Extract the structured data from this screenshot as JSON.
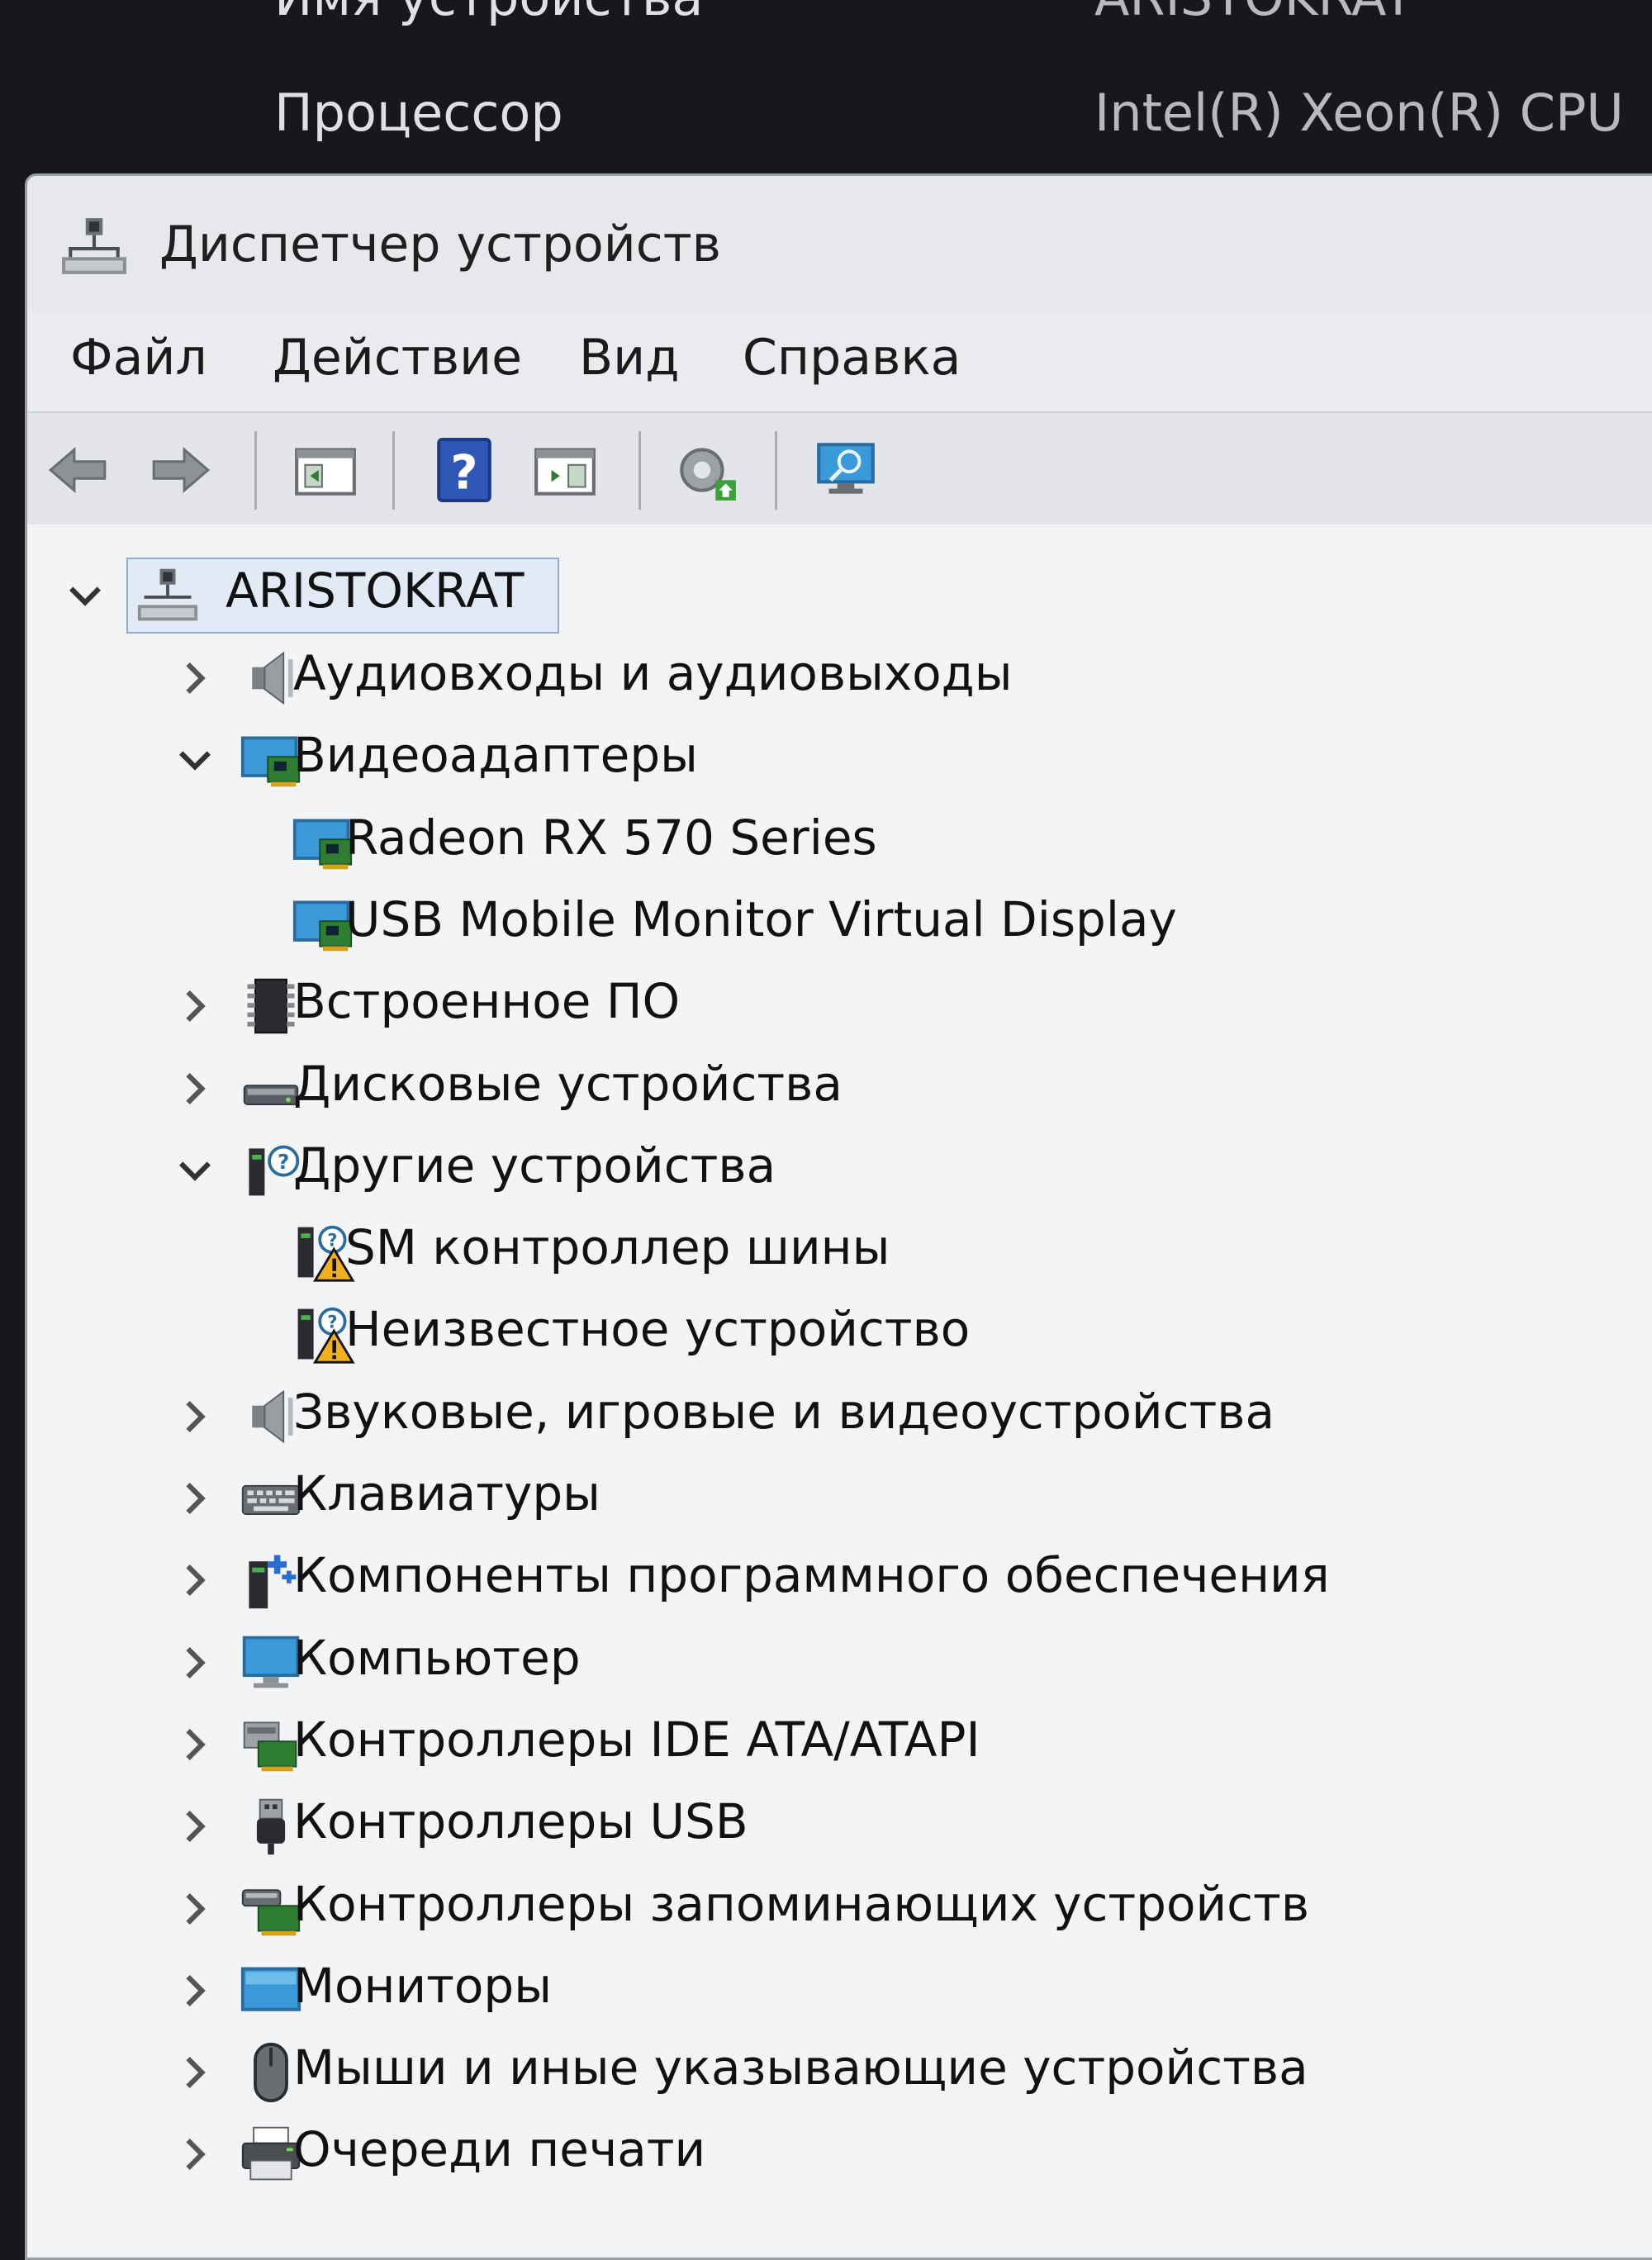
{
  "background_window": {
    "rows": [
      {
        "label": "Имя устройства",
        "value": "ARISTOKRAT"
      },
      {
        "label": "Процессор",
        "value": "Intel(R) Xeon(R) CPU"
      }
    ]
  },
  "window": {
    "title": "Диспетчер устройств",
    "menu": [
      "Файл",
      "Действие",
      "Вид",
      "Справка"
    ]
  },
  "toolbar": {
    "buttons": [
      "back-icon",
      "forward-icon",
      "show-hide-console-tree-icon",
      "help-icon",
      "properties-pane-icon",
      "scan-hardware-icon",
      "monitor-icon"
    ]
  },
  "tree": {
    "root": {
      "label": "ARISTOKRAT",
      "icon": "computer-network-icon",
      "expanded": true
    },
    "items": [
      {
        "label": "Аудиовходы и аудиовыходы",
        "icon": "speaker-icon",
        "level": 1,
        "state": "collapsed"
      },
      {
        "label": "Видеоадаптеры",
        "icon": "display-adapter-icon",
        "level": 1,
        "state": "expanded"
      },
      {
        "label": "Radeon RX 570 Series",
        "icon": "display-adapter-icon",
        "level": 2,
        "state": "leaf"
      },
      {
        "label": "USB Mobile Monitor Virtual Display",
        "icon": "display-adapter-icon",
        "level": 2,
        "state": "leaf"
      },
      {
        "label": "Встроенное ПО",
        "icon": "chip-icon",
        "level": 1,
        "state": "collapsed"
      },
      {
        "label": "Дисковые устройства",
        "icon": "disk-drive-icon",
        "level": 1,
        "state": "collapsed"
      },
      {
        "label": "Другие устройства",
        "icon": "unknown-device-icon",
        "level": 1,
        "state": "expanded"
      },
      {
        "label": "SM контроллер шины",
        "icon": "warning-device-icon",
        "level": 2,
        "state": "leaf"
      },
      {
        "label": "Неизвестное устройство",
        "icon": "warning-device-icon",
        "level": 2,
        "state": "leaf"
      },
      {
        "label": "Звуковые, игровые и видеоустройства",
        "icon": "speaker-icon",
        "level": 1,
        "state": "collapsed"
      },
      {
        "label": "Клавиатуры",
        "icon": "keyboard-icon",
        "level": 1,
        "state": "collapsed"
      },
      {
        "label": "Компоненты программного обеспечения",
        "icon": "software-component-icon",
        "level": 1,
        "state": "collapsed"
      },
      {
        "label": "Компьютер",
        "icon": "monitor-icon",
        "level": 1,
        "state": "collapsed"
      },
      {
        "label": "Контроллеры IDE ATA/ATAPI",
        "icon": "ide-controller-icon",
        "level": 1,
        "state": "collapsed"
      },
      {
        "label": "Контроллеры USB",
        "icon": "usb-icon",
        "level": 1,
        "state": "collapsed"
      },
      {
        "label": "Контроллеры запоминающих устройств",
        "icon": "storage-controller-icon",
        "level": 1,
        "state": "collapsed"
      },
      {
        "label": "Мониторы",
        "icon": "monitor-flat-icon",
        "level": 1,
        "state": "collapsed"
      },
      {
        "label": "Мыши и иные указывающие устройства",
        "icon": "mouse-icon",
        "level": 1,
        "state": "collapsed"
      },
      {
        "label": "Очереди печати",
        "icon": "printer-icon",
        "level": 1,
        "state": "collapsed"
      }
    ]
  },
  "colors": {
    "window_bg": "#eeeff0",
    "selection_border": "#8faed0",
    "warning": "#f2b01e",
    "icon_blue": "#3a9ad9",
    "icon_green": "#2e7d32"
  }
}
